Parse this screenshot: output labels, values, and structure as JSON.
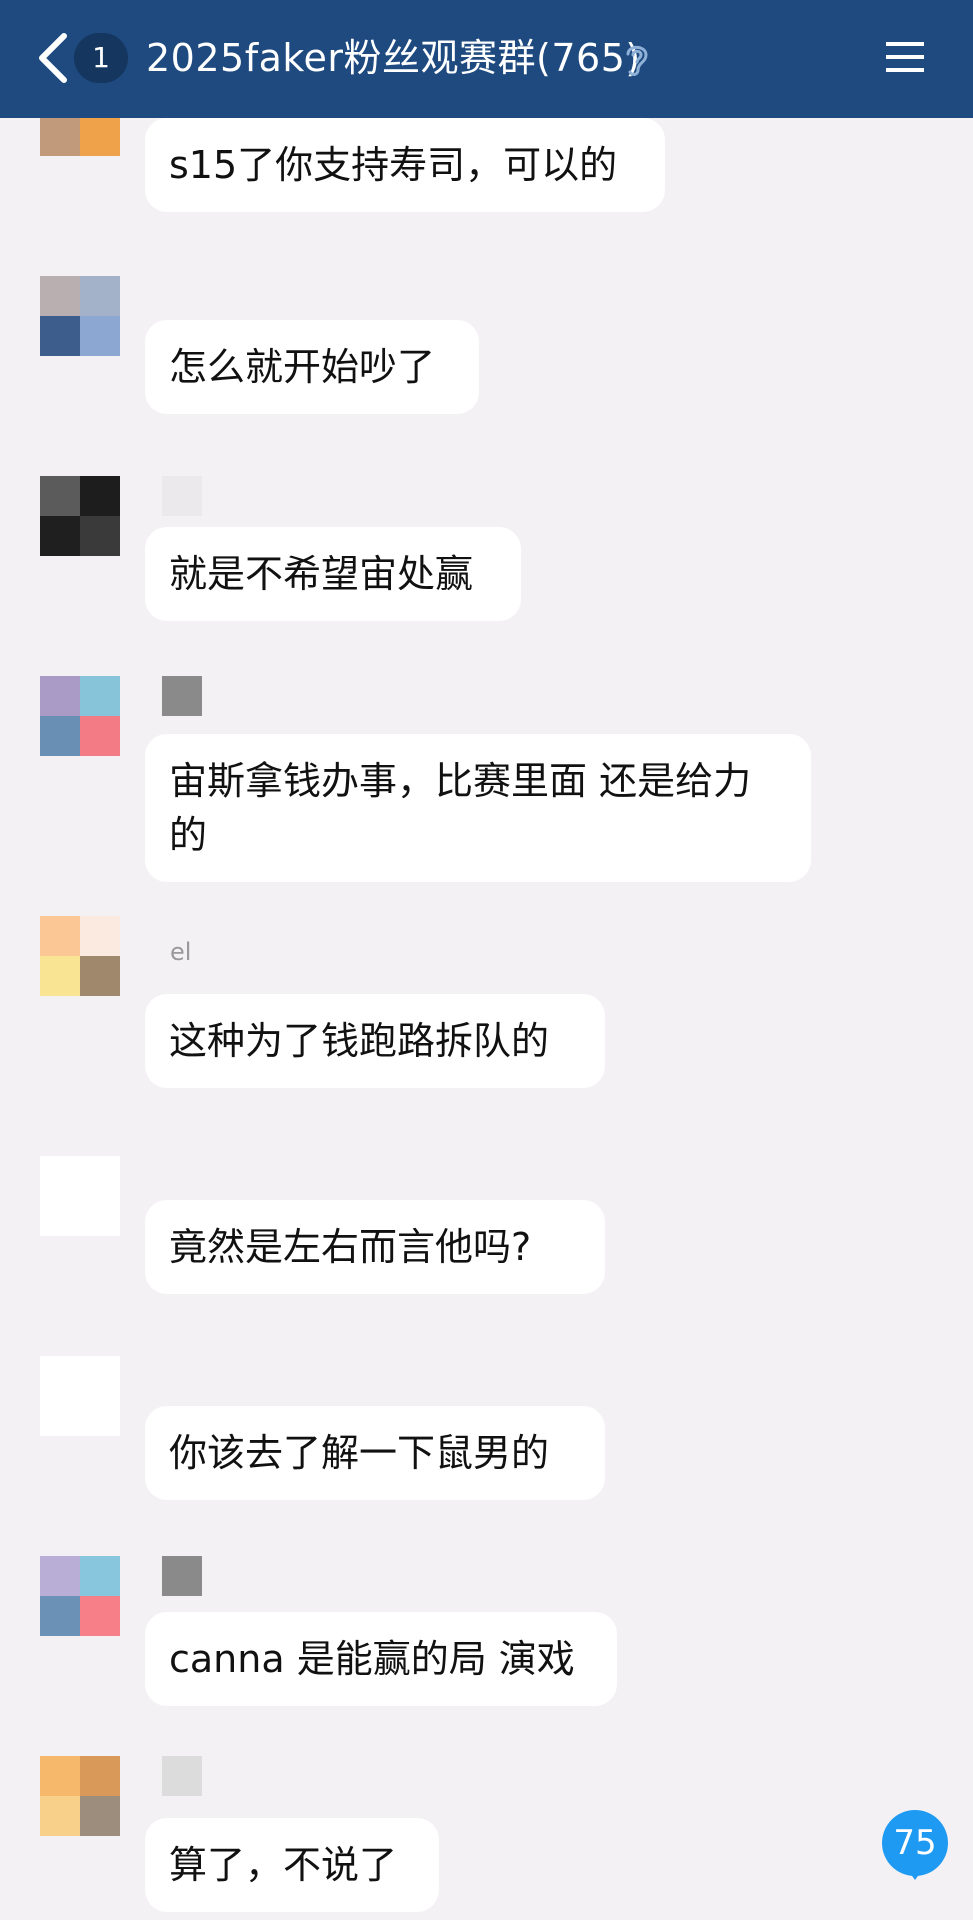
{
  "header": {
    "unread_count": "1",
    "title": "2025faker粉丝观赛群(765)",
    "back_icon": "chevron-left-icon",
    "listen_icon": "ear-icon",
    "menu_icon": "hamburger-menu-icon"
  },
  "messages": [
    {
      "name": "",
      "text": "s15了你支持寿司，可以的",
      "avatar_colors": [
        "#b38a6e",
        "#a8896f",
        "#c19a7c",
        "#f0a24a"
      ]
    },
    {
      "name": "",
      "text": "怎么就开始吵了",
      "avatar_colors": [
        "#b9aeb0",
        "#a3b2c8",
        "#3d5d8c",
        "#8ba7d2"
      ]
    },
    {
      "name": "",
      "text": "就是不希望宙处赢",
      "avatar_colors": [
        "#5b5b5b",
        "#1d1d1d",
        "#1f1f1f",
        "#3a3a3a"
      ]
    },
    {
      "name": "",
      "text": "宙斯拿钱办事，比赛里面 还是给力的",
      "avatar_colors": [
        "#a99bc5",
        "#87c4d9",
        "#6a8fb4",
        "#f27b85"
      ]
    },
    {
      "name": "el",
      "text": "这种为了钱跑路拆队的",
      "avatar_colors": [
        "#fbc895",
        "#fbeadf",
        "#f9e493",
        "#a0886d"
      ]
    },
    {
      "name": "",
      "text": "竟然是左右而言他吗?",
      "avatar_colors": [
        "#ffffff",
        "#ffffff",
        "#ffffff",
        "#ffffff"
      ]
    },
    {
      "name": "",
      "text": "你该去了解一下鼠男的",
      "avatar_colors": [
        "#ffffff",
        "#ffffff",
        "#ffffff",
        "#ffffff"
      ]
    },
    {
      "name": "",
      "text": "canna 是能赢的局 演戏",
      "avatar_colors": [
        "#b8aed6",
        "#87c6dc",
        "#6b91b6",
        "#f78088"
      ]
    },
    {
      "name": "",
      "text": "算了，不说了",
      "avatar_colors": [
        "#f6b86a",
        "#d99a59",
        "#f9d08a",
        "#9d8d7c"
      ]
    }
  ],
  "unread_indicator": "75"
}
